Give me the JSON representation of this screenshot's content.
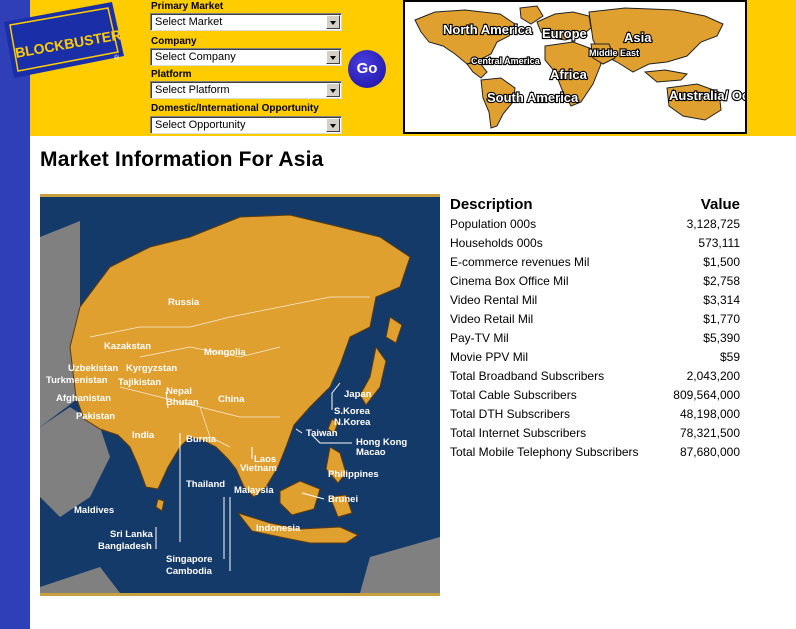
{
  "logo": {
    "text": "BLOCKBUSTER",
    "reg": "®"
  },
  "form": {
    "primary_market": {
      "label": "Primary Market",
      "value": "Select Market"
    },
    "company": {
      "label": "Company",
      "value": "Select Company"
    },
    "platform": {
      "label": "Platform",
      "value": "Select Platform"
    },
    "opportunity": {
      "label": "Domestic/International Opportunity",
      "value": "Select Opportunity"
    },
    "go_label": "Go"
  },
  "world_map": {
    "regions": [
      "North America",
      "Central America",
      "South America",
      "Europe",
      "Middle East",
      "Africa",
      "Asia",
      "Australia/ Oceania"
    ]
  },
  "page_title": "Market Information For Asia",
  "asia_map": {
    "countries": [
      "Russia",
      "Kazakstan",
      "Mongolia",
      "Uzbekistan",
      "Kyrgyzstan",
      "Turkmenistan",
      "Tajikistan",
      "Afghanistan",
      "Pakistan",
      "Nepal",
      "Bhutan",
      "China",
      "India",
      "Burma",
      "Japan",
      "S.Korea",
      "N.Korea",
      "Taiwan",
      "Hong Kong",
      "Macao",
      "Laos",
      "Vietnam",
      "Philippines",
      "Thailand",
      "Malaysia",
      "Brunei",
      "Maldives",
      "Indonesia",
      "Sri Lanka",
      "Bangladesh",
      "Singapore",
      "Cambodia"
    ]
  },
  "table": {
    "headers": {
      "description": "Description",
      "value": "Value"
    },
    "rows": [
      {
        "desc": "Population 000s",
        "value": "3,128,725"
      },
      {
        "desc": "Households 000s",
        "value": "573,111"
      },
      {
        "desc": "E-commerce revenues Mil",
        "value": "$1,500"
      },
      {
        "desc": "Cinema Box Office Mil",
        "value": "$2,758"
      },
      {
        "desc": "Video Rental Mil",
        "value": "$3,314"
      },
      {
        "desc": "Video Retail Mil",
        "value": "$1,770"
      },
      {
        "desc": "Pay-TV Mil",
        "value": "$5,390"
      },
      {
        "desc": "Movie PPV Mil",
        "value": "$59"
      },
      {
        "desc": "Total Broadband Subscribers",
        "value": "2,043,200"
      },
      {
        "desc": "Total Cable Subscribers",
        "value": "809,564,000"
      },
      {
        "desc": "Total DTH Subscribers",
        "value": "48,198,000"
      },
      {
        "desc": "Total Internet Subscribers",
        "value": "78,321,500"
      },
      {
        "desc": "Total Mobile Telephony Subscribers",
        "value": "87,680,000"
      }
    ]
  },
  "colors": {
    "header_bg": "#ffcc00",
    "stripe": "#2f3fb8",
    "land": "#e0a030",
    "ocean": "#143a6a",
    "logo_blue": "#1a2ea8"
  }
}
